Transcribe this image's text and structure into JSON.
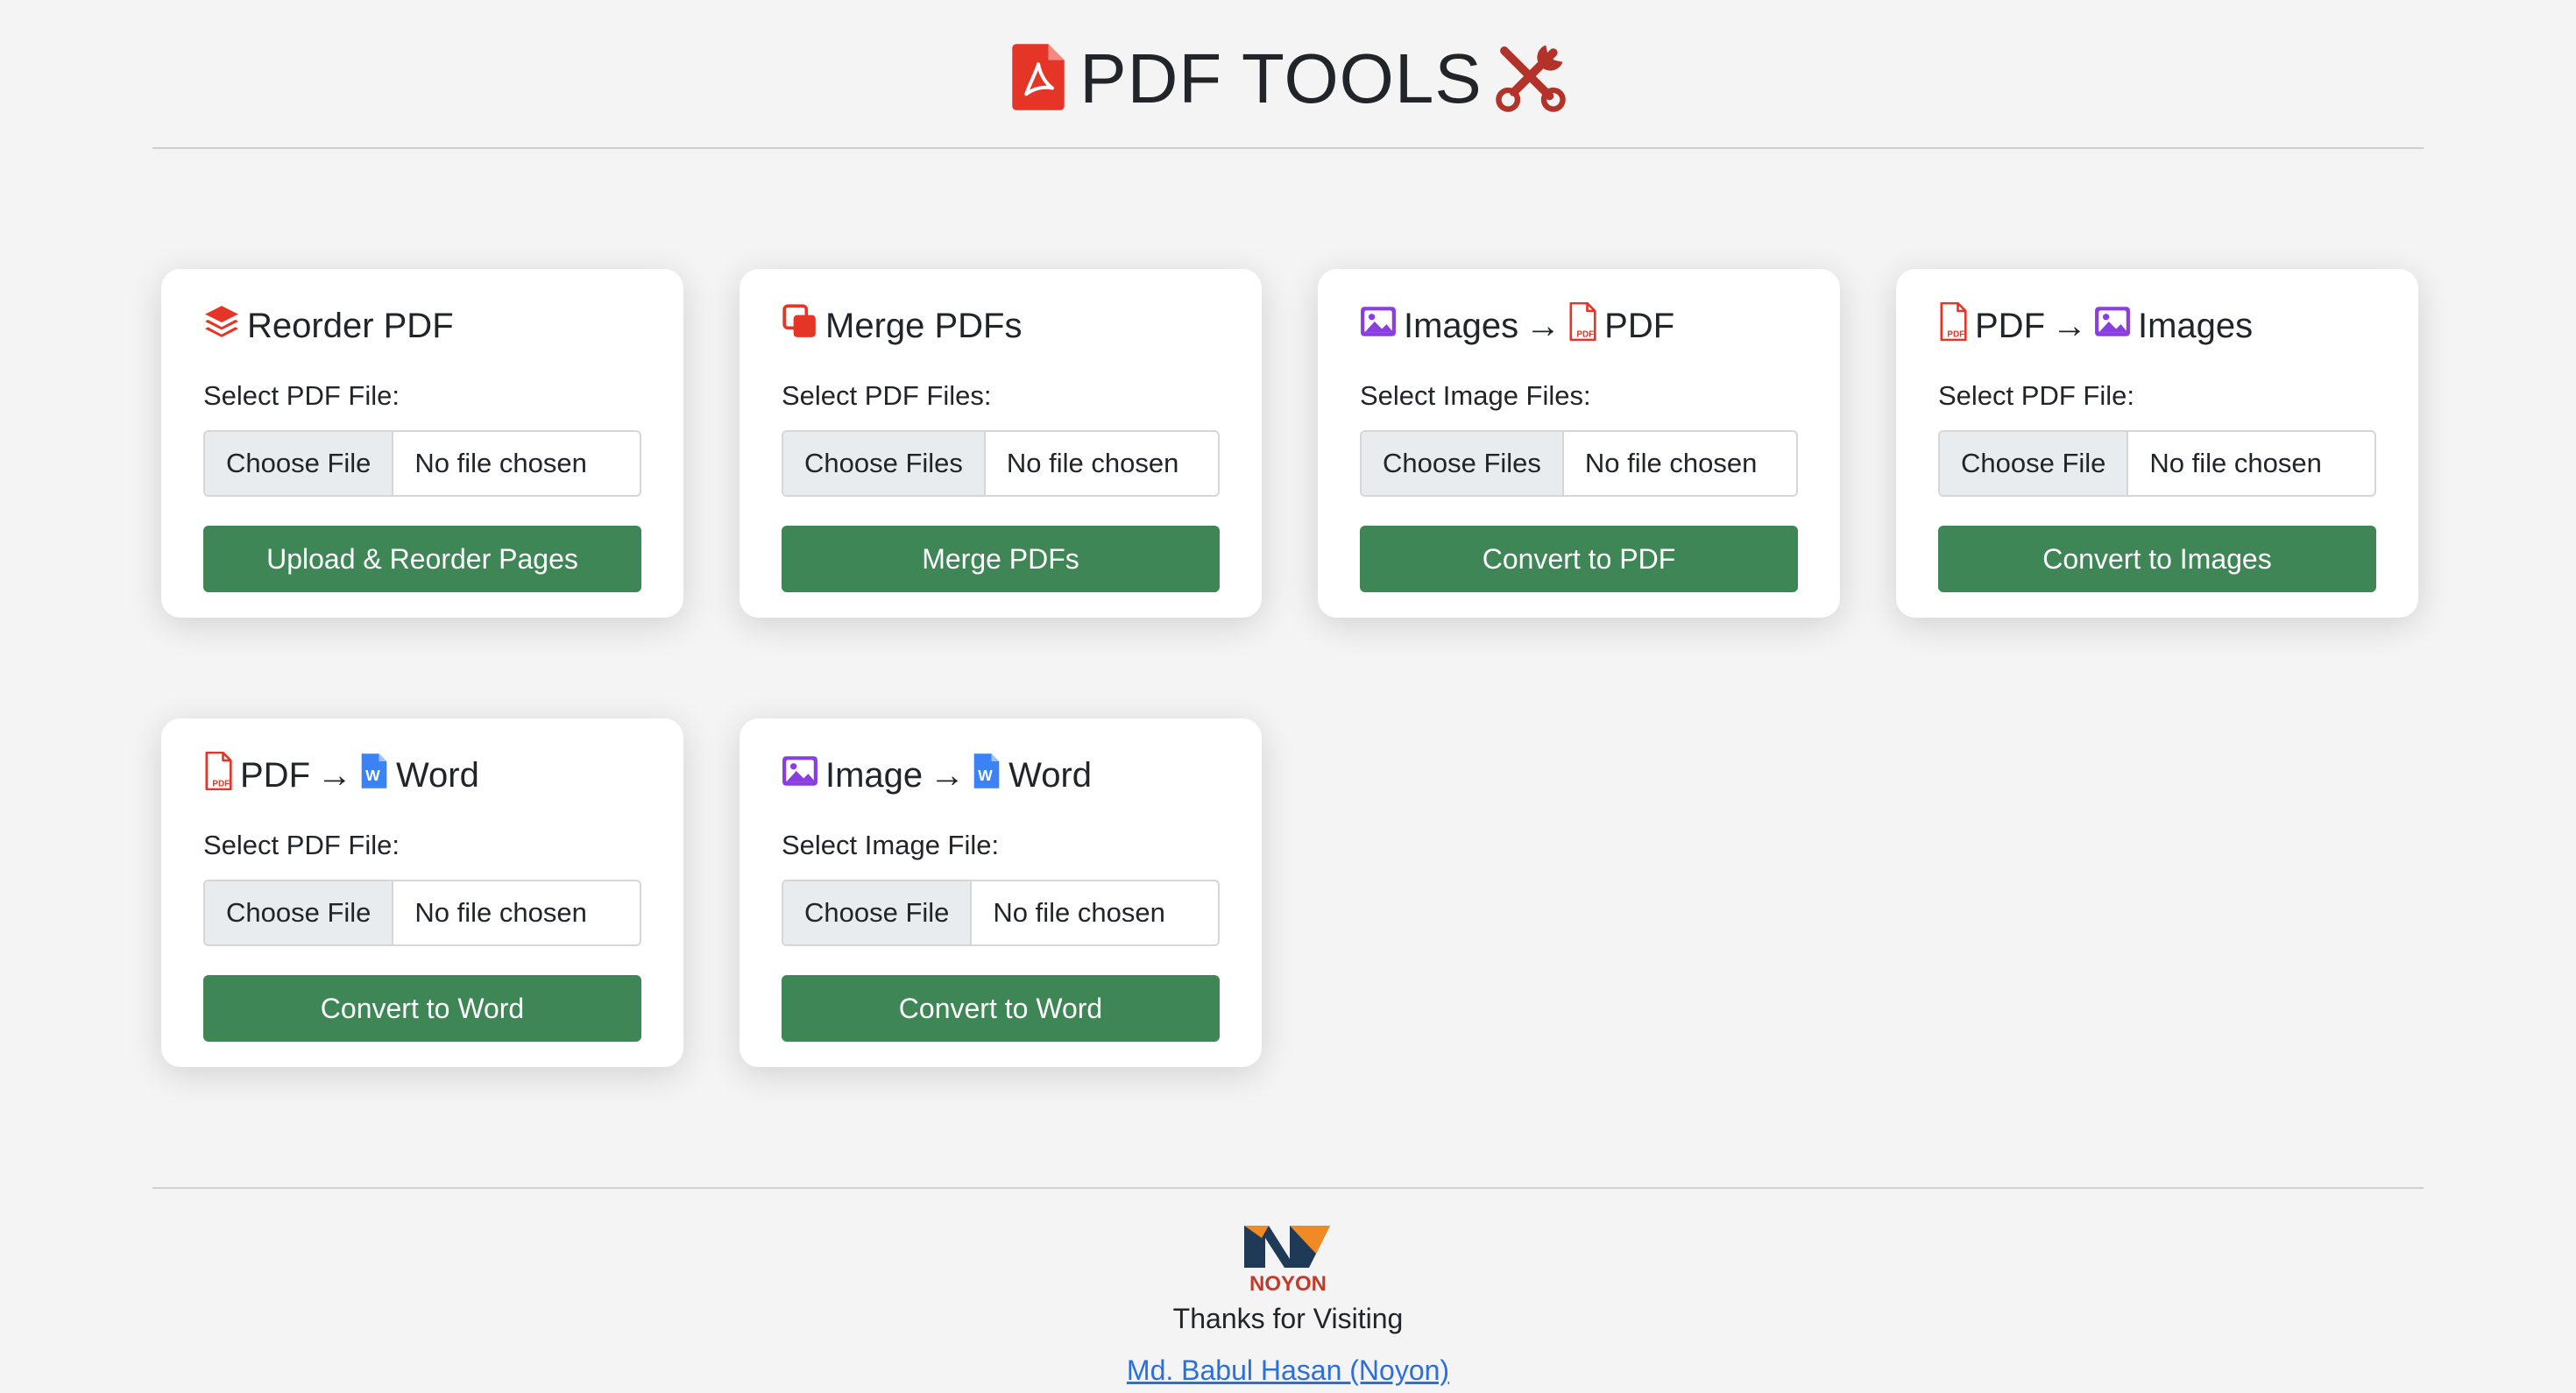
{
  "header": {
    "title": "PDF TOOLS"
  },
  "cards": [
    {
      "title": "Reorder PDF",
      "label": "Select PDF File:",
      "choose": "Choose File",
      "status": "No file chosen",
      "action": "Upload & Reorder Pages"
    },
    {
      "title": "Merge PDFs",
      "label": "Select PDF Files:",
      "choose": "Choose Files",
      "status": "No file chosen",
      "action": "Merge PDFs"
    },
    {
      "title_a": "Images",
      "arrow": "→",
      "title_b": "PDF",
      "label": "Select Image Files:",
      "choose": "Choose Files",
      "status": "No file chosen",
      "action": "Convert to PDF"
    },
    {
      "title_a": "PDF",
      "arrow": "→",
      "title_b": "Images",
      "label": "Select PDF File:",
      "choose": "Choose File",
      "status": "No file chosen",
      "action": "Convert to Images"
    },
    {
      "title_a": "PDF",
      "arrow": "→",
      "title_b": "Word",
      "label": "Select PDF File:",
      "choose": "Choose File",
      "status": "No file chosen",
      "action": "Convert to Word"
    },
    {
      "title_a": "Image",
      "arrow": "→",
      "title_b": "Word",
      "label": "Select Image File:",
      "choose": "Choose File",
      "status": "No file chosen",
      "action": "Convert to Word"
    }
  ],
  "footer": {
    "logo_text": "NOYON",
    "thanks": "Thanks for Visiting",
    "author": "Md. Babul Hasan (Noyon)"
  },
  "icons": [
    "pdf-icon",
    "tools-icon",
    "layers-icon",
    "merge-icon",
    "image-icon",
    "word-icon"
  ],
  "colors": {
    "accent_red": "#e53527",
    "button_green": "#3f8656",
    "image_purple": "#8a3ee0",
    "word_blue": "#3b82f6",
    "link_blue": "#2a6fdb"
  }
}
